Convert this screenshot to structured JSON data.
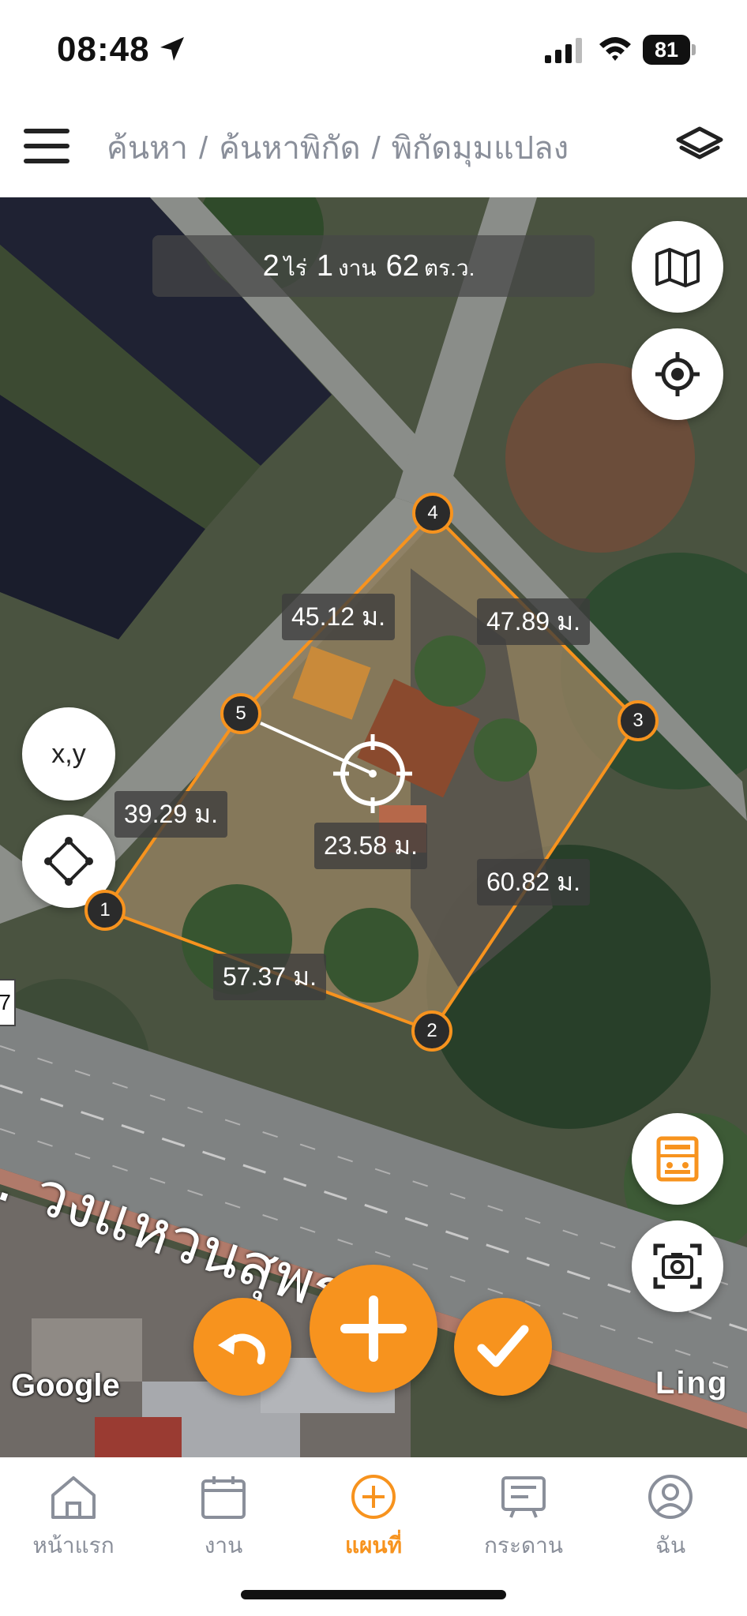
{
  "status_bar": {
    "time": "08:48",
    "battery": "81",
    "icons": [
      "location-arrow-icon",
      "signal-icon",
      "wifi-icon",
      "battery-icon"
    ]
  },
  "header": {
    "breadcrumb": [
      "ค้นหา",
      "ค้นหาพิกัด",
      "พิกัดมุมแปลง"
    ],
    "separator": "/",
    "icons": [
      "menu-icon",
      "layers-icon"
    ]
  },
  "map": {
    "area": {
      "rai_value": "2",
      "rai_unit": "ไร่",
      "ngan_value": "1",
      "ngan_unit": "งาน",
      "wa_value": "62",
      "wa_unit": "ตร.ว."
    },
    "vertices": [
      "1",
      "2",
      "3",
      "4",
      "5"
    ],
    "dimensions": {
      "edge_4_5": "45.12 ม.",
      "edge_4_3": "47.89 ม.",
      "edge_5_1": "39.29 ม.",
      "center_line": "23.58 ม.",
      "edge_3_2": "60.82 ม.",
      "edge_1_2": "57.37 ม."
    },
    "road_name": ". วงแหวนสุพร",
    "attribution": "Google",
    "watermark": "Ling",
    "edge_tag": "7",
    "xy_button_label": "x,y",
    "accent_color": "#f7931e"
  },
  "bottom_nav": {
    "items": [
      {
        "label": "หน้าแรก",
        "icon": "home-icon"
      },
      {
        "label": "งาน",
        "icon": "calendar-icon"
      },
      {
        "label": "แผนที่",
        "icon": "add-circle-icon"
      },
      {
        "label": "กระดาน",
        "icon": "board-icon"
      },
      {
        "label": "ฉัน",
        "icon": "user-icon"
      }
    ],
    "active_index": 2
  }
}
